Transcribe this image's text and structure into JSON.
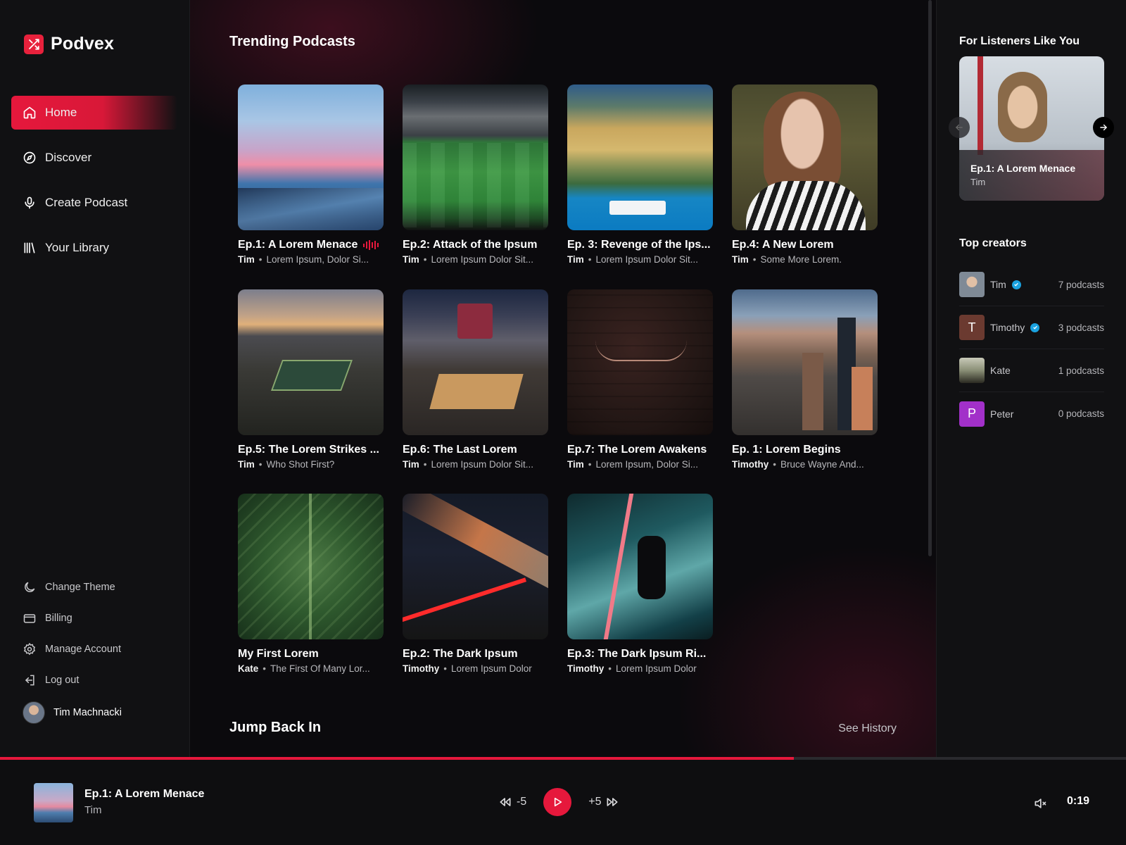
{
  "app": {
    "name": "Podvex"
  },
  "nav": {
    "items": [
      {
        "label": "Home",
        "icon": "home-icon",
        "active": true
      },
      {
        "label": "Discover",
        "icon": "compass-icon"
      },
      {
        "label": "Create Podcast",
        "icon": "microphone-icon"
      },
      {
        "label": "Your Library",
        "icon": "library-icon"
      }
    ],
    "secondary": [
      {
        "label": "Change Theme",
        "icon": "moon-icon"
      },
      {
        "label": "Billing",
        "icon": "credit-card-icon"
      },
      {
        "label": "Manage Account",
        "icon": "gear-icon"
      },
      {
        "label": "Log out",
        "icon": "logout-icon"
      }
    ],
    "user": {
      "name": "Tim Machnacki"
    }
  },
  "trending": {
    "title": "Trending Podcasts",
    "cards": [
      {
        "title": "Ep.1: A Lorem Menace",
        "author": "Tim",
        "desc": "Lorem Ipsum, Dolor Si...",
        "playing": true
      },
      {
        "title": "Ep.2: Attack of the Ipsum",
        "author": "Tim",
        "desc": "Lorem Ipsum Dolor Sit..."
      },
      {
        "title": "Ep. 3: Revenge of the Ips...",
        "author": "Tim",
        "desc": "Lorem Ipsum Dolor Sit..."
      },
      {
        "title": "Ep.4: A New Lorem",
        "author": "Tim",
        "desc": "Some More Lorem."
      },
      {
        "title": "Ep.5: The Lorem Strikes ...",
        "author": "Tim",
        "desc": "Who Shot First?"
      },
      {
        "title": "Ep.6: The Last Lorem",
        "author": "Tim",
        "desc": "Lorem Ipsum Dolor Sit..."
      },
      {
        "title": "Ep.7: The Lorem Awakens",
        "author": "Tim",
        "desc": "Lorem Ipsum, Dolor Si..."
      },
      {
        "title": "Ep. 1: Lorem Begins",
        "author": "Timothy",
        "desc": "Bruce Wayne And..."
      },
      {
        "title": "My First Lorem",
        "author": "Kate",
        "desc": "The First Of Many Lor..."
      },
      {
        "title": "Ep.2: The Dark Ipsum",
        "author": "Timothy",
        "desc": "Lorem Ipsum Dolor"
      },
      {
        "title": "Ep.3: The Dark Ipsum Ri...",
        "author": "Timothy",
        "desc": "Lorem Ipsum Dolor"
      }
    ]
  },
  "jump_back": {
    "title": "Jump Back In",
    "link": "See History"
  },
  "right_panel": {
    "for_listeners_title": "For Listeners Like You",
    "feature": {
      "title": "Ep.1: A Lorem Menace",
      "author": "Tim"
    },
    "top_creators_title": "Top creators",
    "creators": [
      {
        "name": "Tim",
        "verified": true,
        "count": "7 podcasts",
        "initial": "",
        "color": "#6f7a88"
      },
      {
        "name": "Timothy",
        "verified": true,
        "count": "3 podcasts",
        "initial": "T",
        "color": "#6b3a30"
      },
      {
        "name": "Kate",
        "verified": false,
        "count": "1 podcasts",
        "initial": "",
        "color": "#8a8f76"
      },
      {
        "name": "Peter",
        "verified": false,
        "count": "0 podcasts",
        "initial": "P",
        "color": "#a230c9"
      }
    ]
  },
  "player": {
    "title": "Ep.1: A Lorem Menace",
    "author": "Tim",
    "rewind_label": "-5",
    "forward_label": "+5",
    "time": "0:19",
    "progress": 0.705
  },
  "colors": {
    "accent": "#e6183c",
    "verified": "#1aa2e0"
  }
}
